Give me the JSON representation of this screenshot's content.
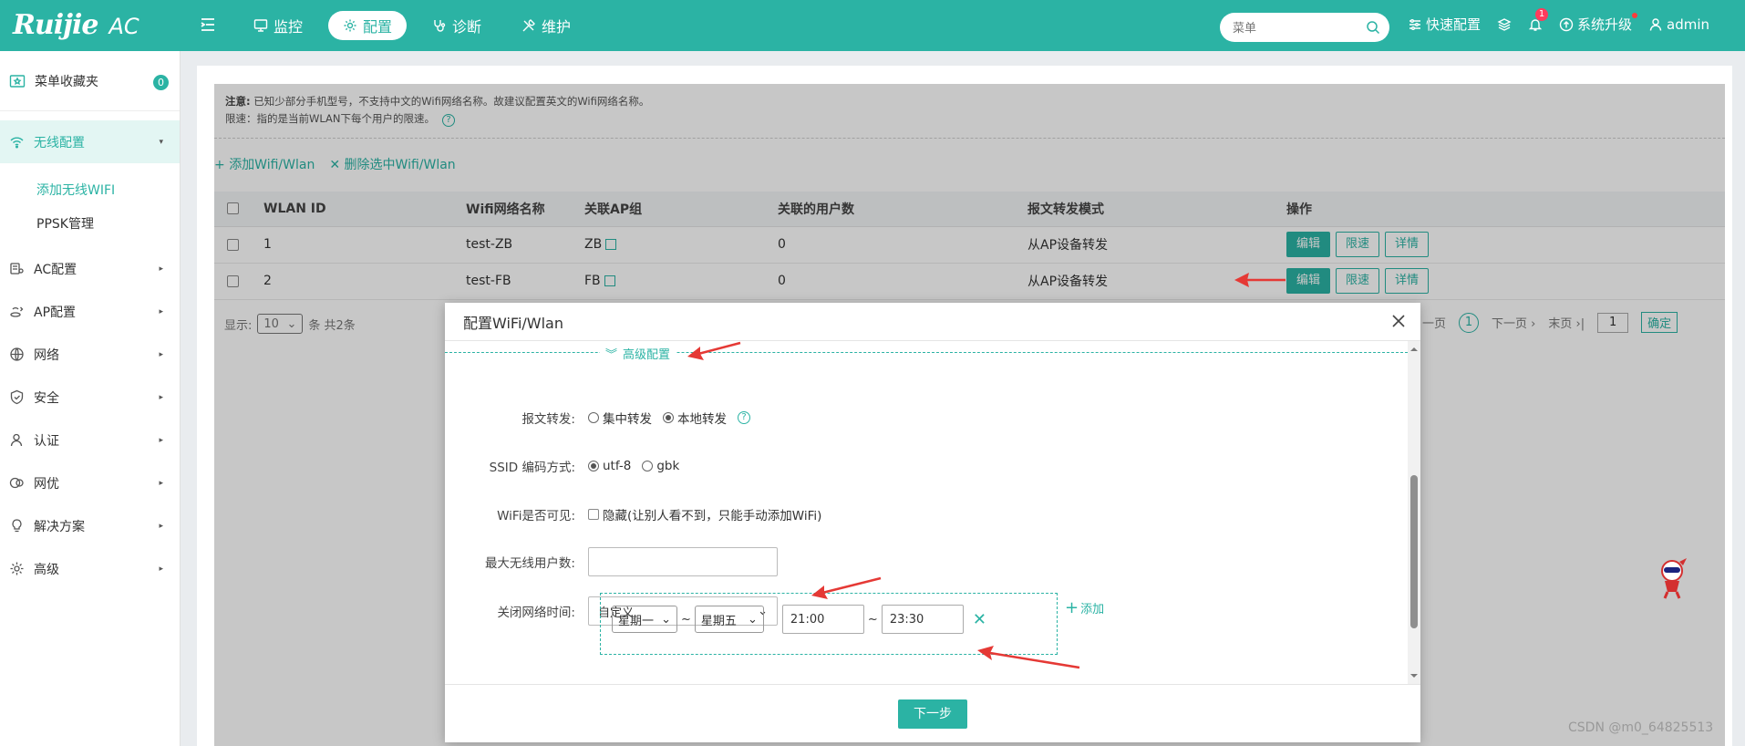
{
  "brand": {
    "name": "Ruijie",
    "product": "AC"
  },
  "topnav": [
    {
      "label": "监控",
      "icon": "monitor-icon",
      "active": false
    },
    {
      "label": "配置",
      "icon": "gear-icon",
      "active": true
    },
    {
      "label": "诊断",
      "icon": "stethoscope-icon",
      "active": false
    },
    {
      "label": "维护",
      "icon": "wrench-icon",
      "active": false
    }
  ],
  "search": {
    "placeholder": "菜单"
  },
  "topright": {
    "quick_config": "快速配置",
    "notif_count": "1",
    "upgrade": "系统升级",
    "user": "admin"
  },
  "sidebar": {
    "fav_label": "菜单收藏夹",
    "fav_count": "0",
    "items": [
      {
        "label": "无线配置",
        "icon": "wifi-icon"
      },
      {
        "label": "AC配置",
        "icon": "ac-config-icon"
      },
      {
        "label": "AP配置",
        "icon": "ap-config-icon"
      },
      {
        "label": "网络",
        "icon": "globe-icon"
      },
      {
        "label": "安全",
        "icon": "shield-icon"
      },
      {
        "label": "认证",
        "icon": "user-icon"
      },
      {
        "label": "网优",
        "icon": "optimize-icon"
      },
      {
        "label": "解决方案",
        "icon": "bulb-icon"
      },
      {
        "label": "高级",
        "icon": "settings-icon"
      }
    ],
    "subitems": [
      {
        "label": "添加无线WIFI",
        "active": true
      },
      {
        "label": "PPSK管理",
        "active": false
      }
    ]
  },
  "notice": {
    "label": "注意:",
    "line1": "已知少部分手机型号，不支持中文的Wifi网络名称。故建议配置英文的Wifi网络名称。",
    "line2": "限速：指的是当前WLAN下每个用户的限速。"
  },
  "actions": {
    "add": "添加Wifi/Wlan",
    "delete": "删除选中Wifi/Wlan"
  },
  "table": {
    "headers": [
      "WLAN ID",
      "Wifi网络名称",
      "关联AP组",
      "关联的用户数",
      "报文转发模式",
      "操作"
    ],
    "rows": [
      {
        "id": "1",
        "ssid": "test-ZB",
        "apgroup": "ZB",
        "users": "0",
        "mode": "从AP设备转发"
      },
      {
        "id": "2",
        "ssid": "test-FB",
        "apgroup": "FB",
        "users": "0",
        "mode": "从AP设备转发"
      }
    ],
    "btn_edit": "编辑",
    "btn_limit": "限速",
    "btn_detail": "详情"
  },
  "pager": {
    "show_label": "显示:",
    "page_size": "10",
    "total": "条 共2条",
    "prev": "一页",
    "current": "1",
    "next": "下一页",
    "last": "末页",
    "goto": "1",
    "ok": "确定"
  },
  "modal": {
    "title": "配置WiFi/Wlan",
    "advanced": "高级配置",
    "forward_label": "报文转发:",
    "forward_opt1": "集中转发",
    "forward_opt2": "本地转发",
    "ssid_enc_label": "SSID 编码方式:",
    "ssid_enc_opt1": "utf-8",
    "ssid_enc_opt2": "gbk",
    "visible_label": "WiFi是否可见:",
    "visible_opt": "隐藏(让别人看不到，只能手动添加WiFi)",
    "max_users_label": "最大无线用户数:",
    "max_users_value": "",
    "close_time_label": "关闭网络时间:",
    "close_time_value": "自定义",
    "day_from": "星期一",
    "day_to": "星期五",
    "time_sep": "~",
    "time_from": "21:00",
    "time_to": "23:30",
    "add_label": "添加",
    "next": "下一步"
  },
  "watermark": "CSDN @m0_64825513",
  "colors": {
    "accent": "#2bb3a4",
    "annotation": "#e53935"
  }
}
